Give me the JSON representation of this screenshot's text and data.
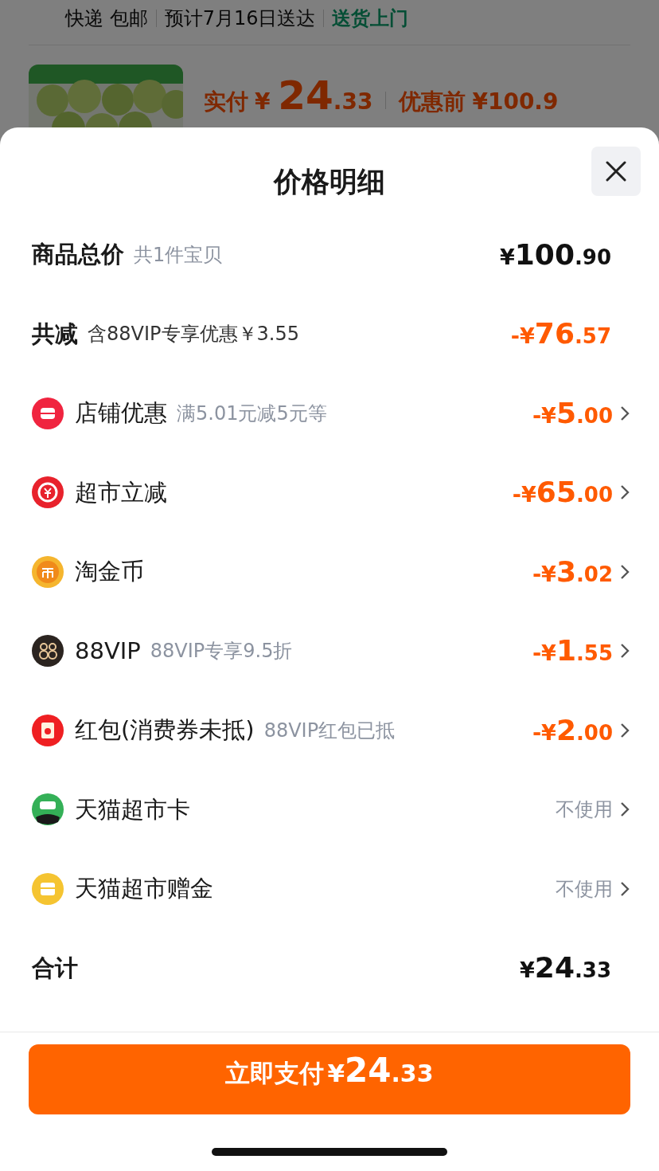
{
  "background": {
    "delivery": [
      "快递 包邮",
      "预计7月16日送达"
    ],
    "delivery_highlight": "送货上门",
    "paid_label": "实付",
    "paid_amount": "¥ 24.33",
    "original_label": "优惠前",
    "original_amount": "¥100.9"
  },
  "sheet": {
    "title": "价格明细",
    "rows": [
      {
        "kind": "total",
        "label": "商品总价",
        "note": "共1件宝贝",
        "amount": "¥100.90"
      },
      {
        "kind": "reduction",
        "label": "共减",
        "note": "含88VIP专享优惠￥3.55",
        "amount": "-¥76.57"
      },
      {
        "kind": "discount",
        "label": "店铺优惠",
        "note": "满5.01元减5元等",
        "amount": "-¥5.00"
      },
      {
        "kind": "discount",
        "label": "超市立减",
        "amount": "-¥65.00"
      },
      {
        "kind": "discount",
        "label": "淘金币",
        "amount": "-¥3.02"
      },
      {
        "kind": "discount",
        "label": "88VIP",
        "note": "88VIP专享9.5折",
        "amount": "-¥1.55"
      },
      {
        "kind": "discount",
        "label": "红包(消费券未抵)",
        "note": "88VIP红包已抵",
        "amount": "-¥2.00"
      },
      {
        "kind": "option",
        "label": "天猫超市卡",
        "amount": "不使用"
      },
      {
        "kind": "option",
        "label": "天猫超市赠金",
        "amount": "不使用"
      },
      {
        "kind": "total",
        "label": "合计",
        "amount": "¥24.33"
      }
    ],
    "pay_button": {
      "label": "立即支付",
      "amount": "¥24.33"
    }
  }
}
